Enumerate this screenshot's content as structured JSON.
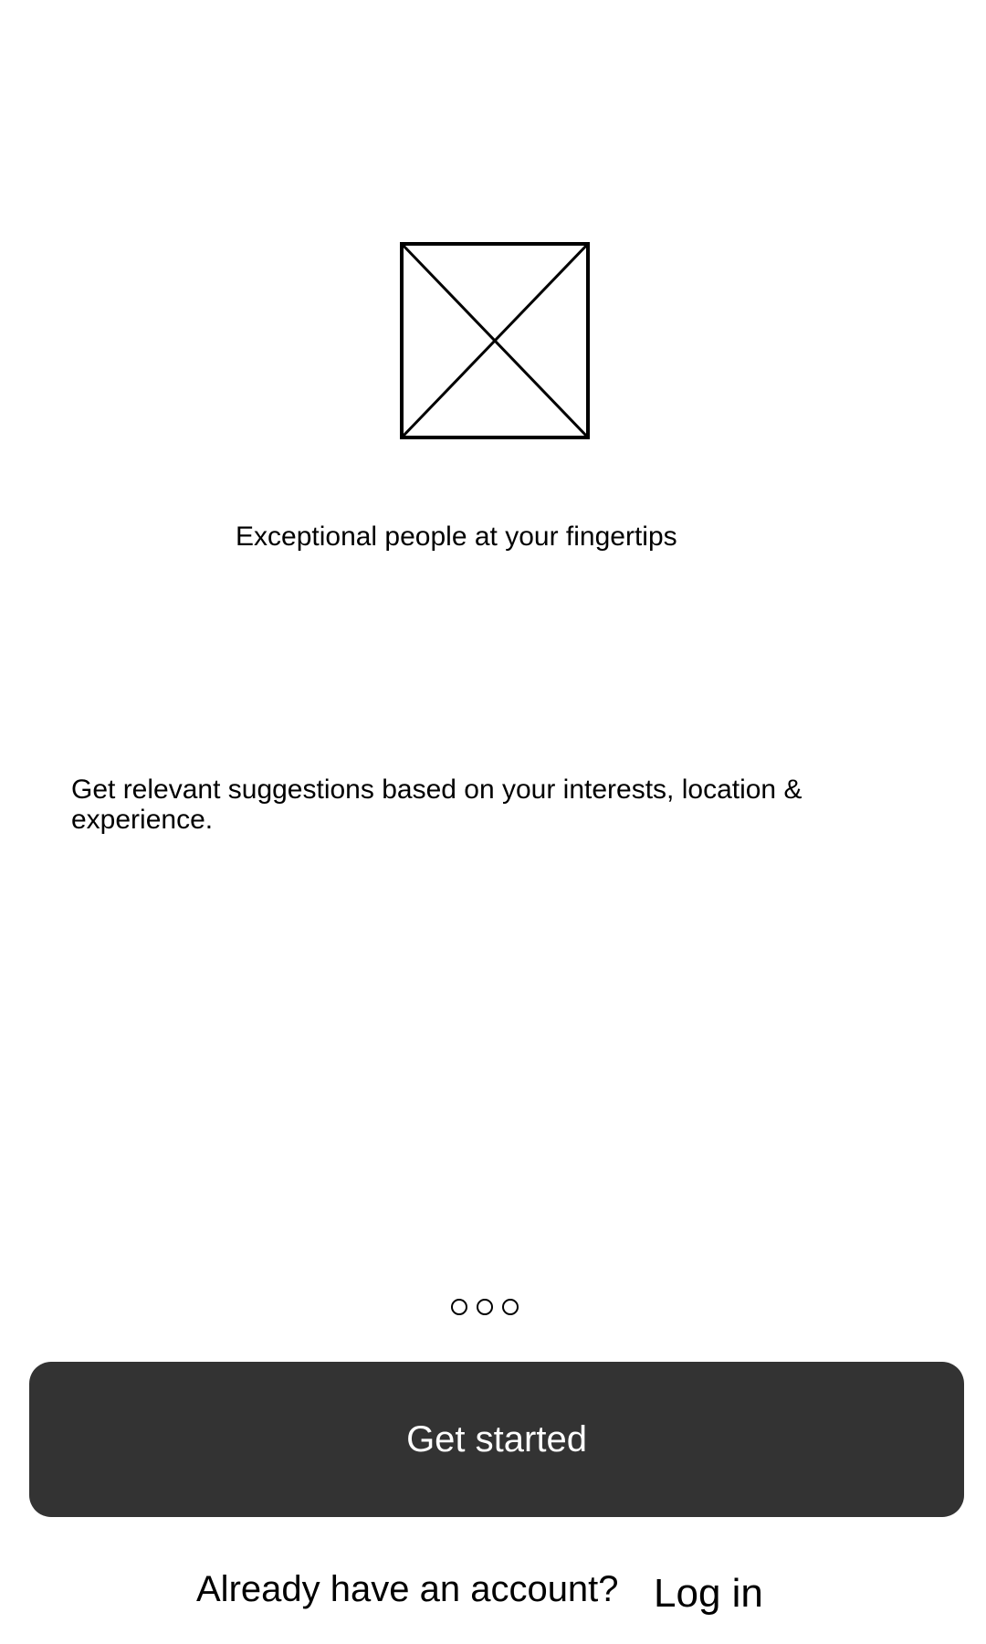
{
  "onboarding": {
    "headline": "Exceptional people at your fingertips",
    "description": "Get relevant suggestions based on your interests, location & experience.",
    "pager": {
      "total": 3,
      "active_index": null
    },
    "hero_icon": "image-placeholder-icon"
  },
  "actions": {
    "primary_label": "Get started",
    "login_prompt": "Already have an account?",
    "login_label": "Log in"
  },
  "colors": {
    "background": "#ffffff",
    "button_background": "#333333",
    "button_text": "#ffffff",
    "text": "#000000"
  }
}
